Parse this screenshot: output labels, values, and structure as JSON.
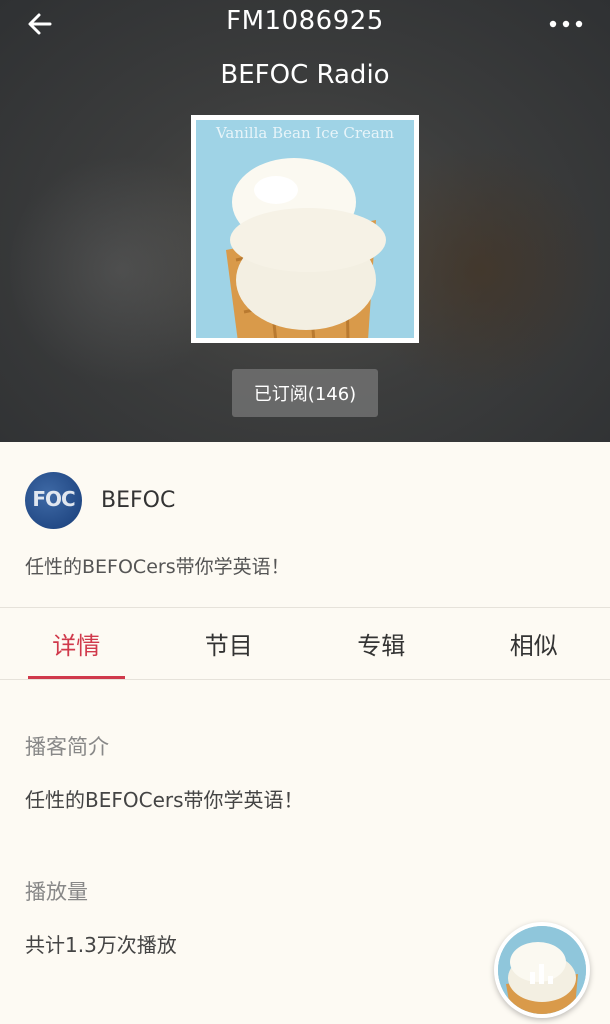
{
  "header": {
    "title": "FM1086925",
    "subtitle": "BEFOC Radio",
    "cover_caption": "Vanilla Bean Ice Cream",
    "subscribe_label": "已订阅(146)",
    "subscriber_count": 146
  },
  "author": {
    "avatar_text": "FOC",
    "name": "BEFOC",
    "description": "任性的BEFOCers带你学英语！"
  },
  "tabs": [
    {
      "label": "详情",
      "active": true
    },
    {
      "label": "节目",
      "active": false
    },
    {
      "label": "专辑",
      "active": false
    },
    {
      "label": "相似",
      "active": false
    }
  ],
  "details": {
    "intro_label": "播客简介",
    "intro_text": "任性的BEFOCers带你学英语！",
    "plays_label": "播放量",
    "plays_text": "共计1.3万次播放"
  },
  "icons": {
    "back": "arrow-left-icon",
    "more": "more-dots-icon",
    "player": "equalizer-bars-icon"
  },
  "colors": {
    "accent": "#d0394b",
    "background": "#fdfaf3",
    "header_dark": "#3c3d3d"
  }
}
